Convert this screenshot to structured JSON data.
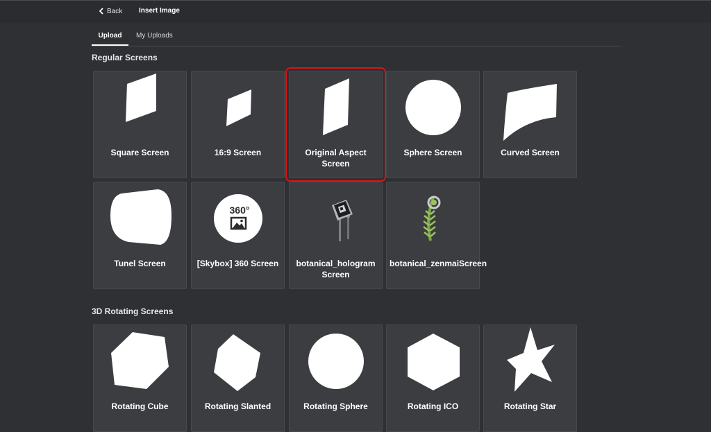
{
  "header": {
    "back_label": "Back",
    "title": "Insert Image"
  },
  "tabs": [
    {
      "label": "Upload",
      "active": true
    },
    {
      "label": "My Uploads",
      "active": false
    }
  ],
  "sections": {
    "regular": {
      "title": "Regular Screens",
      "items": [
        {
          "label": "Square Screen",
          "icon": "square-screen-icon"
        },
        {
          "label": "16:9 Screen",
          "icon": "widescreen-icon"
        },
        {
          "label": "Original Aspect Screen",
          "icon": "original-aspect-icon",
          "selected": true
        },
        {
          "label": "Sphere Screen",
          "icon": "sphere-icon"
        },
        {
          "label": "Curved Screen",
          "icon": "curved-screen-icon"
        },
        {
          "label": "Tunel Screen",
          "icon": "tunnel-icon"
        },
        {
          "label": "[Skybox] 360 Screen",
          "icon": "skybox-360-icon",
          "badge": "360°"
        },
        {
          "label": "botanical_hologram Screen",
          "icon": "hologram-kiosk-icon"
        },
        {
          "label": "botanical_zenmaiScreen",
          "icon": "fern-icon"
        }
      ]
    },
    "rotating": {
      "title": "3D Rotating Screens",
      "items": [
        {
          "label": "Rotating Cube",
          "icon": "hexagon-cube-icon"
        },
        {
          "label": "Rotating Slanted",
          "icon": "slanted-hexagon-icon"
        },
        {
          "label": "Rotating Sphere",
          "icon": "circle-icon"
        },
        {
          "label": "Rotating ICO",
          "icon": "icosahedron-icon"
        },
        {
          "label": "Rotating Star",
          "icon": "star-icon"
        }
      ]
    }
  },
  "colors": {
    "background": "#2e3033",
    "card": "#3b3d40",
    "selection": "#e01010",
    "text": "#ffffff"
  }
}
